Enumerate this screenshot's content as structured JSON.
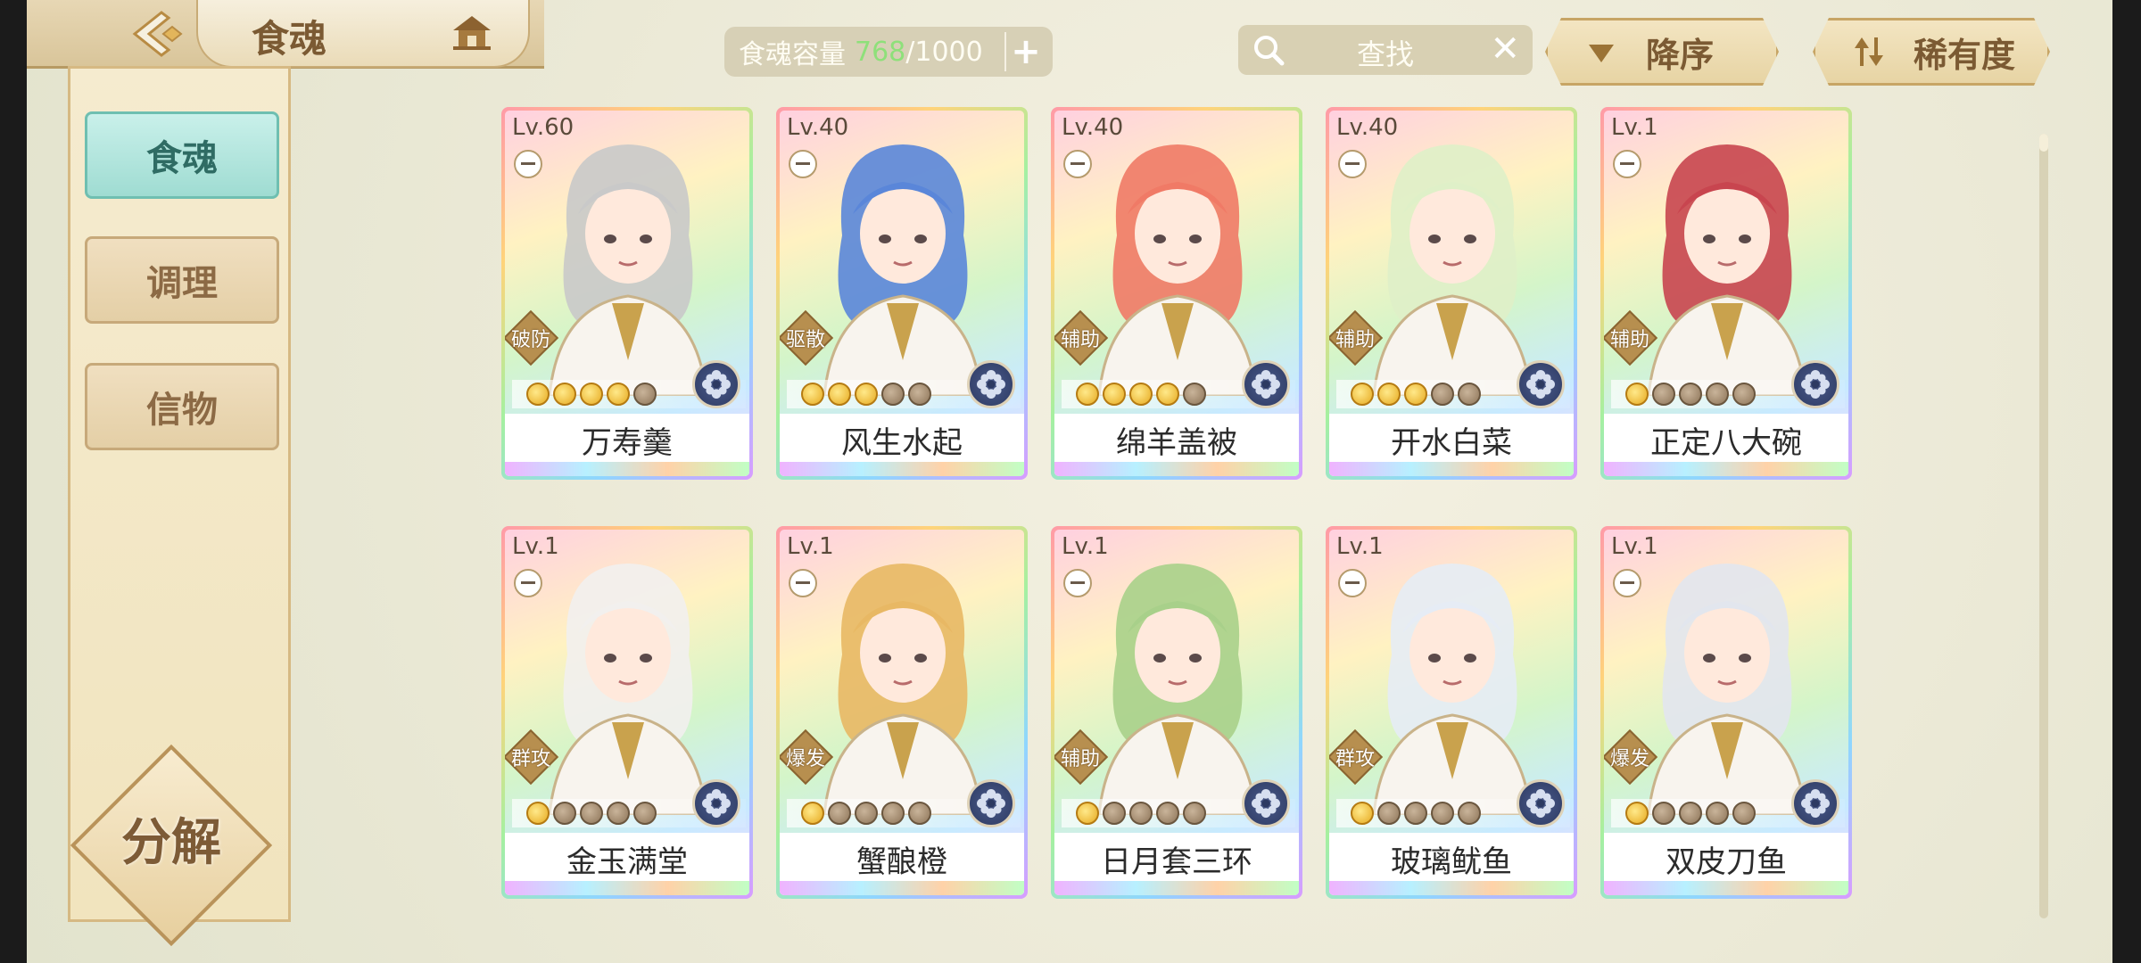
{
  "header": {
    "title": "食魂"
  },
  "capacity": {
    "label": "食魂容量",
    "current": "768",
    "max": "/1000"
  },
  "search": {
    "placeholder": "查找"
  },
  "sort": {
    "order_label": "降序",
    "rarity_label": "稀有度"
  },
  "sidebar": {
    "items": [
      {
        "label": "食魂",
        "active": true
      },
      {
        "label": "调理",
        "active": false
      },
      {
        "label": "信物",
        "active": false
      }
    ],
    "decompose_label": "分解"
  },
  "cards": [
    {
      "level": "Lv.60",
      "name": "万寿羹",
      "role": "破防",
      "stars": 4,
      "hair": "#c9c9c9"
    },
    {
      "level": "Lv.40",
      "name": "风生水起",
      "role": "驱散",
      "stars": 3,
      "hair": "#5a86d9"
    },
    {
      "level": "Lv.40",
      "name": "绵羊盖被",
      "role": "辅助",
      "stars": 4,
      "hair": "#f07a66"
    },
    {
      "level": "Lv.40",
      "name": "开水白菜",
      "role": "辅助",
      "stars": 3,
      "hair": "#dff0c8"
    },
    {
      "level": "Lv.1",
      "name": "正定八大碗",
      "role": "辅助",
      "stars": 1,
      "hair": "#c8454f"
    },
    {
      "level": "Lv.1",
      "name": "金玉满堂",
      "role": "群攻",
      "stars": 1,
      "hair": "#f2f0ee"
    },
    {
      "level": "Lv.1",
      "name": "蟹酿橙",
      "role": "爆发",
      "stars": 1,
      "hair": "#e8b864"
    },
    {
      "level": "Lv.1",
      "name": "日月套三环",
      "role": "辅助",
      "stars": 1,
      "hair": "#a8d08a"
    },
    {
      "level": "Lv.1",
      "name": "玻璃鱿鱼",
      "role": "群攻",
      "stars": 1,
      "hair": "#e6ecf5"
    },
    {
      "level": "Lv.1",
      "name": "双皮刀鱼",
      "role": "爆发",
      "stars": 1,
      "hair": "#e2e6ee"
    }
  ],
  "colors": {
    "accent": "#9fdcd2",
    "capacity_current": "#8ee07a",
    "frame": "#c7a565"
  }
}
